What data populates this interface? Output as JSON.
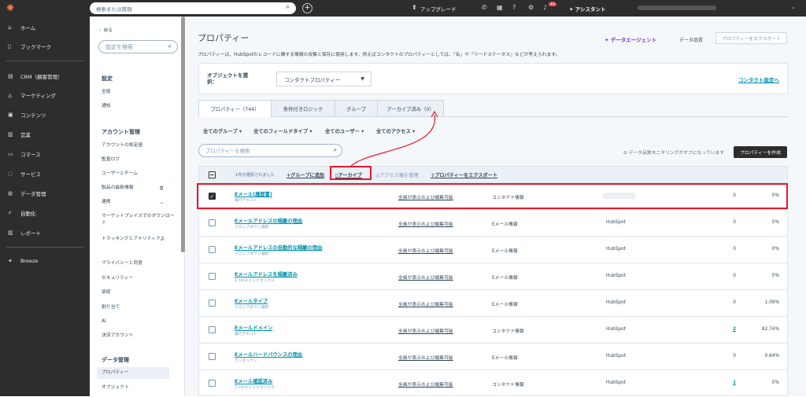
{
  "topbar": {
    "search_placeholder": "検索または質問",
    "upgrade": "アップグレード",
    "notif_count": "15",
    "assistant": "アシスタント"
  },
  "nav": {
    "items": [
      "ホーム",
      "ブックマーク",
      "CRM（顧客管理）",
      "マーケティング",
      "コンテンツ",
      "営業",
      "コマース",
      "サービス",
      "データ管理",
      "自動化",
      "レポート",
      "Breeze"
    ]
  },
  "settings": {
    "back": "戻る",
    "search_placeholder": "設定を検索",
    "sec1": "設定",
    "sec1_items": [
      "全般",
      "通知"
    ],
    "sec2": "アカウント管理",
    "sec2_items": [
      "アカウントの既定値",
      "監査ログ",
      "ユーザーとチーム",
      "製品の最新情報",
      "連携",
      "マーケットプレイスでのダウンロード",
      "トラッキングとアナリティクス",
      "プライバシーと同意",
      "セキュリティー",
      "承認",
      "割り当て",
      "AI",
      "決済アカウント"
    ],
    "sec3": "データ管理",
    "sec3_items": [
      "プロパティー",
      "オブジェクト"
    ]
  },
  "page": {
    "title": "プロパティー",
    "data_agent": "データエージェント",
    "data_quality": "データ品質",
    "export_btn": "プロパティーをエクスポート",
    "description": "プロパティーは、HubSpotのレコードに関する情報の収集と保存に使用します。例えばコンタクトのプロパティーとしては、「名」や「リードステータス」などが考えられます。",
    "object_label_1": "オブジェクトを選",
    "object_label_2": "択：",
    "object_value": "コンタクトプロパティー",
    "contact_settings": "コンタクト設定へ"
  },
  "tabs": [
    {
      "label": "プロパティー（744）"
    },
    {
      "label": "条件付きロジック"
    },
    {
      "label": "グループ"
    },
    {
      "label": "アーカイブ済み（0）"
    }
  ],
  "filters": [
    "全てのグループ",
    "全てのフィールドタイプ",
    "全てのユーザー",
    "全てのアクセス"
  ],
  "search_placeholder": "プロパティーを検索",
  "monitor_text": "データ品質モニタリングがオフになっています",
  "create_btn": "プロパティーを作成",
  "bulk": {
    "selected": "1件が選択されました",
    "add_group": "+グループに追加",
    "archive": "アーカイブ",
    "access": "アクセス権を管理",
    "export": "プロパティーをエクスポート"
  },
  "rows": [
    {
      "name": "Eメール(履歴書)",
      "type": "複行テキスト",
      "access": "全員が表示および編集可能",
      "group": "コンタクト情報",
      "created": "",
      "usage": "0",
      "fill": "0%",
      "checked": true
    },
    {
      "name": "Eメールアドレスの隔離の理由",
      "type": "ドロップダウン選択",
      "access": "全員が表示および編集可能",
      "group": "Eメール情報",
      "created": "HubSpot",
      "usage": "0",
      "fill": "0%"
    },
    {
      "name": "Eメールアドレスの自動的な隔離の理由",
      "type": "ドロップダウン選択",
      "access": "全員が表示および編集可能",
      "group": "Eメール情報",
      "created": "HubSpot",
      "usage": "0",
      "fill": "0%"
    },
    {
      "name": "Eメールアドレスを隔離済み",
      "type": "1つのチェックボックス",
      "access": "全員が表示および編集可能",
      "group": "Eメール情報",
      "created": "HubSpot",
      "usage": "0",
      "fill": "0%"
    },
    {
      "name": "Eメールタイプ",
      "type": "ドロップダウン選択",
      "access": "全員が表示および編集可能",
      "group": "Eメール情報",
      "created": "HubSpot",
      "usage": "0",
      "fill": "1.09%"
    },
    {
      "name": "Eメールドメイン",
      "type": "複行テキスト",
      "access": "全員が表示および編集可能",
      "group": "コンタクト情報",
      "created": "HubSpot",
      "usage": "2",
      "fill": "82.74%",
      "usage_link": true
    },
    {
      "name": "Eメールハードバウンスの理由",
      "type": "ランオンテン",
      "access": "全員が表示および編集可能",
      "group": "Eメール情報",
      "created": "HubSpot",
      "usage": "0",
      "fill": "0.64%"
    },
    {
      "name": "Eメール確認済み",
      "type": "1つのチェックボックス",
      "access": "全員が表示および編集可能",
      "group": "コンタクト情報",
      "created": "HubSpot",
      "usage": "1",
      "fill": "0%",
      "usage_link": true
    }
  ],
  "colors": {
    "topbar": "#2d2d2d",
    "accent_link": "#0091ae",
    "highlight": "#e8192c",
    "agent": "#7b2eda"
  }
}
